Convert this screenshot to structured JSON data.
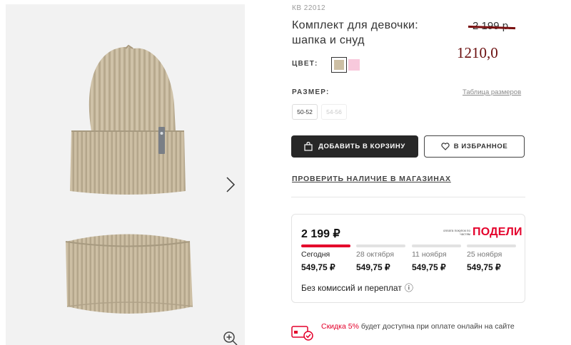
{
  "product": {
    "sku": "КВ 22012",
    "title": "Комплект для девочки: шапка и снуд",
    "old_price": "2 199 р.",
    "new_price": "1210,0"
  },
  "color": {
    "label": "ЦВЕТ:",
    "swatches": [
      {
        "name": "beige",
        "color": "#cdbfa4",
        "selected": true
      },
      {
        "name": "pink",
        "color": "#f8c9dc",
        "selected": false
      }
    ]
  },
  "size": {
    "label": "РАЗМЕР:",
    "table_link": "Таблица размеров",
    "options": [
      {
        "label": "50-52",
        "available": true
      },
      {
        "label": "54-56",
        "available": false
      }
    ]
  },
  "actions": {
    "add_to_cart": "ДОБАВИТЬ В КОРЗИНУ",
    "favorite": "В ИЗБРАННОЕ",
    "check_stores": "ПРОВЕРИТЬ НАЛИЧИЕ В МАГАЗИНАХ"
  },
  "split": {
    "total": "2 199 ₽",
    "note": "оплата покупок по частям",
    "logo": "ПОДЕЛИ",
    "installments": [
      {
        "date": "Сегодня",
        "amount": "549,75 ₽",
        "active": true
      },
      {
        "date": "28 октября",
        "amount": "549,75 ₽",
        "active": false
      },
      {
        "date": "11 ноября",
        "amount": "549,75 ₽",
        "active": false
      },
      {
        "date": "25 ноября",
        "amount": "549,75 ₽",
        "active": false
      }
    ],
    "no_fee": "Без комиссий и переплат",
    "info_icon": "ⓘ"
  },
  "promo": {
    "discount": "Скидка 5%",
    "text": " будет доступна при оплате онлайн на сайте"
  },
  "colors": {
    "accent": "#e4002b",
    "dark_button": "#272727",
    "product_beige": "#cdbfa4",
    "new_price": "#6a0d0d"
  },
  "icons": {
    "next": "chevron-right-icon",
    "zoom": "zoom-in-icon",
    "bag": "shopping-bag-icon",
    "heart": "heart-icon",
    "card": "card-check-icon"
  }
}
